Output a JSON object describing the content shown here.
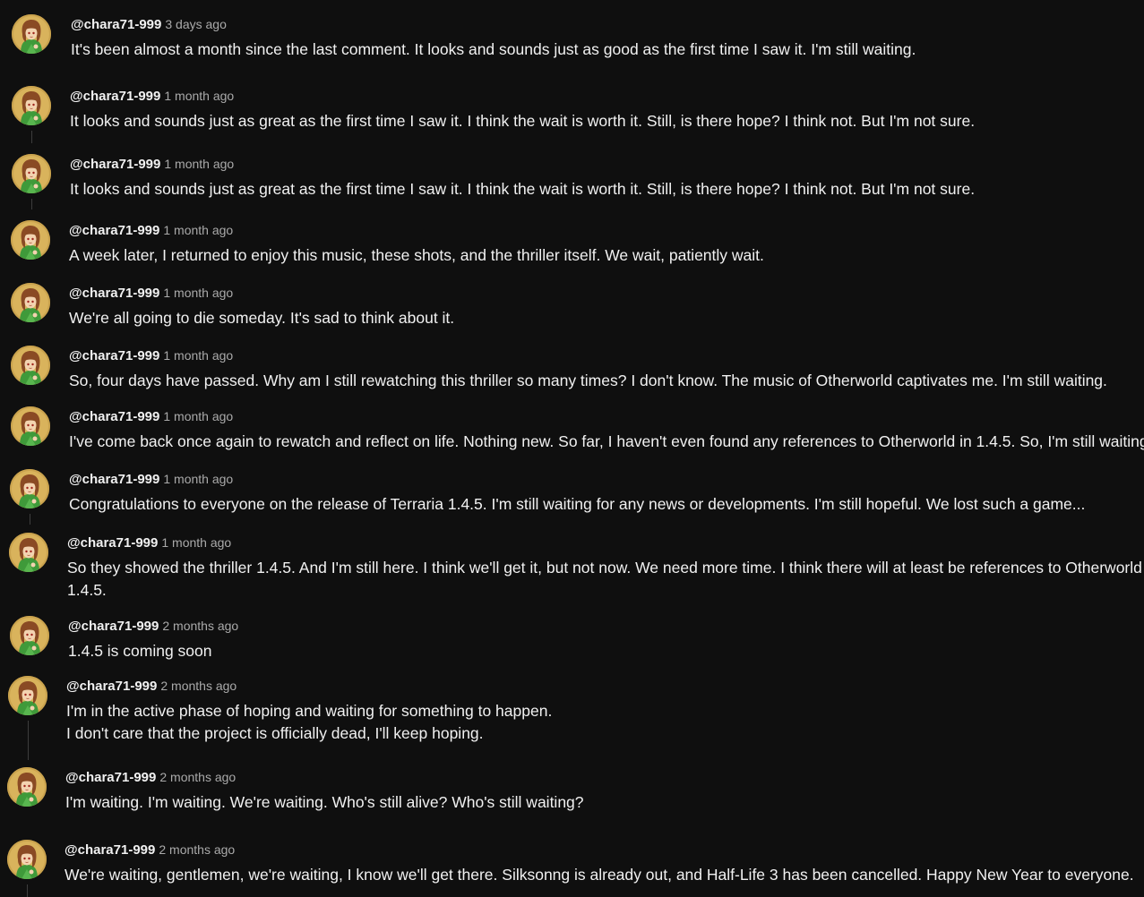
{
  "comments": [
    {
      "author": "@chara71-999",
      "time": "3 days ago",
      "lines": [
        "It's been almost a month since the last comment. It looks and sounds just as good as the first time I saw it. I'm still waiting."
      ]
    },
    {
      "author": "@chara71-999",
      "time": "1 month ago",
      "lines": [
        "It looks and sounds just as great as the first time I saw it. I think the wait is worth it. Still, is there hope? I think not. But I'm not sure."
      ]
    },
    {
      "author": "@chara71-999",
      "time": "1 month ago",
      "lines": [
        "It looks and sounds just as great as the first time I saw it. I think the wait is worth it. Still, is there hope? I think not. But I'm not sure."
      ]
    },
    {
      "author": "@chara71-999",
      "time": "1 month ago",
      "lines": [
        "A week later, I returned to enjoy this music, these shots, and the thriller itself. We wait, patiently wait."
      ]
    },
    {
      "author": "@chara71-999",
      "time": "1 month ago",
      "lines": [
        "We're all going to die someday. It's sad to think about it."
      ]
    },
    {
      "author": "@chara71-999",
      "time": "1 month ago",
      "lines": [
        "So, four days have passed. Why am I still rewatching this thriller so many times? I don't know. The music of Otherworld captivates me. I'm still waiting."
      ]
    },
    {
      "author": "@chara71-999",
      "time": "1 month ago",
      "lines": [
        "I've come back once again to rewatch and reflect on life. Nothing new. So far, I haven't even found any references to Otherworld in 1.4.5. So, I'm still waiting."
      ]
    },
    {
      "author": "@chara71-999",
      "time": "1 month ago",
      "lines": [
        "Congratulations to everyone on the release of Terraria 1.4.5. I'm still waiting for any news or developments. I'm still hopeful. We lost such a game..."
      ]
    },
    {
      "author": "@chara71-999",
      "time": "1 month ago",
      "lines": [
        "So they showed the thriller 1.4.5. And I'm still here. I think we'll get it, but not now. We need more time. I think there will at least be references to Otherworld i",
        "1.4.5."
      ]
    },
    {
      "author": "@chara71-999",
      "time": "2 months ago",
      "lines": [
        "1.4.5 is coming soon"
      ]
    },
    {
      "author": "@chara71-999",
      "time": "2 months ago",
      "lines": [
        "I'm in the active phase of hoping and waiting for something to happen.",
        "I don't care that the project is officially dead, I'll keep hoping."
      ]
    },
    {
      "author": "@chara71-999",
      "time": "2 months ago",
      "lines": [
        "I'm waiting. I'm waiting. We're waiting. Who's still alive? Who's still waiting?"
      ]
    },
    {
      "author": "@chara71-999",
      "time": "2 months ago",
      "lines": [
        "We're waiting, gentlemen, we're waiting, I know we'll get there. Silksonng is already out, and Half-Life 3 has been cancelled. Happy New Year to everyone."
      ]
    }
  ]
}
